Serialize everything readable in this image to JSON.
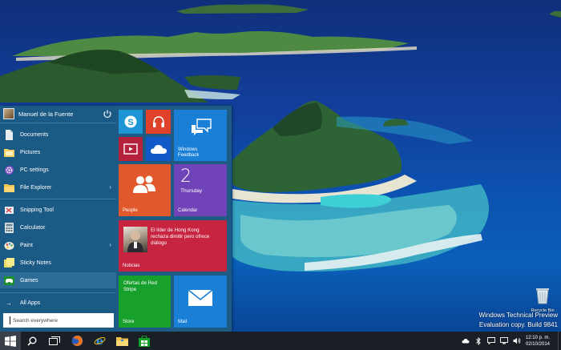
{
  "user": {
    "name": "Manuel de la Fuente"
  },
  "menu_items": [
    {
      "label": "Documents",
      "icon": "documents-icon"
    },
    {
      "label": "Pictures",
      "icon": "pictures-icon"
    },
    {
      "label": "PC settings",
      "icon": "gear-icon"
    },
    {
      "label": "File Explorer",
      "icon": "folder-icon",
      "has_submenu": true
    },
    {
      "label": "Snipping Tool",
      "icon": "scissors-icon"
    },
    {
      "label": "Calculator",
      "icon": "calculator-icon"
    },
    {
      "label": "Paint",
      "icon": "paint-icon",
      "has_submenu": true
    },
    {
      "label": "Sticky Notes",
      "icon": "sticky-notes-icon"
    },
    {
      "label": "Games",
      "icon": "games-icon",
      "selected": true
    }
  ],
  "all_apps_label": "All Apps",
  "search": {
    "placeholder": "Search everywhere"
  },
  "tiles": {
    "skype": {
      "label": "",
      "color": "#1e96d6"
    },
    "music": {
      "label": "",
      "color": "#e0412b"
    },
    "video": {
      "label": "",
      "color": "#b5203b"
    },
    "onedrive": {
      "label": "",
      "color": "#0f5ac8"
    },
    "feedback": {
      "label": "Windows\nFeedback",
      "color": "#1a7fd6"
    },
    "people": {
      "label": "People",
      "color": "#e0582c"
    },
    "calendar": {
      "label": "Calendar",
      "day_number": "2",
      "day_name": "Thursday",
      "color": "#7143b8"
    },
    "news": {
      "label": "Noticias",
      "headline": "El líder de Hong Kong rechaza dimitir pero ofrece diálogo",
      "color": "#c7243f"
    },
    "store": {
      "label": "Store",
      "promo": "Ofertas de Red Stripe",
      "color": "#18a02d"
    },
    "mail": {
      "label": "Mail",
      "color": "#1a7fd6"
    }
  },
  "taskbar": {
    "buttons": [
      "start-icon",
      "search-icon",
      "task-view-icon",
      "firefox-icon",
      "internet-explorer-icon",
      "file-explorer-icon",
      "store-icon"
    ],
    "clock_time": "12:10 p. m.",
    "clock_date": "02/10/2014"
  },
  "desktop": {
    "recycle_bin_label": "Recycle Bin",
    "watermark_line1": "Windows Technical Preview",
    "watermark_line2": "Evaluation copy. Build 9841"
  },
  "colors": {
    "start_menu_bg": "#1b5a84",
    "taskbar_bg": "#1a1f26",
    "accent": "#2d6c97"
  }
}
